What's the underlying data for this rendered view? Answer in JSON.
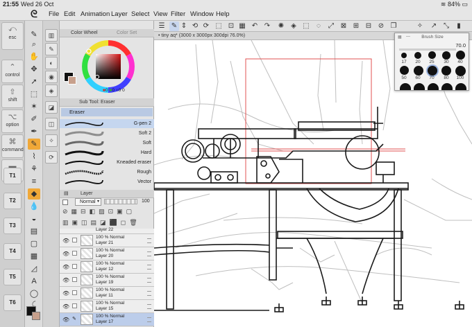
{
  "status": {
    "time": "21:55",
    "date": "Wed 26 Oct",
    "battery": "84%"
  },
  "menu": [
    "File",
    "Edit",
    "Animation",
    "Layer",
    "Select",
    "View",
    "Filter",
    "Window",
    "Help"
  ],
  "modifiers": [
    {
      "label": "esc",
      "icon": "esc-icon"
    },
    {
      "label": "control",
      "icon": "control-icon"
    },
    {
      "label": "shift",
      "icon": "shift-icon"
    },
    {
      "label": "option",
      "icon": "option-icon"
    },
    {
      "label": "command",
      "icon": "command-icon"
    },
    {
      "label": "space",
      "icon": "space-icon"
    }
  ],
  "tkeys": [
    "T1",
    "T2",
    "T3",
    "T4",
    "T5",
    "T6"
  ],
  "color_wheel": {
    "tab_active": "Color Wheel",
    "tab_inactive": "Color Set",
    "values": [
      "0",
      "0",
      "0",
      "0"
    ]
  },
  "subtool": {
    "header": "Sub Tool: Eraser",
    "active_group": "Eraser"
  },
  "brushes": [
    {
      "name": "G-pen 2",
      "selected": true
    },
    {
      "name": "Soft 2",
      "selected": false
    },
    {
      "name": "Soft",
      "selected": false
    },
    {
      "name": "Hard",
      "selected": false
    },
    {
      "name": "Kneaded eraser",
      "selected": false
    },
    {
      "name": "Rough",
      "selected": false
    },
    {
      "name": "Vector",
      "selected": false
    }
  ],
  "layer_panel": {
    "title": "Layer",
    "blend_mode": "Normal",
    "opacity": "100"
  },
  "layers": [
    {
      "mode": "",
      "name": "Layer 22",
      "selected": false
    },
    {
      "mode": "100 % Normal",
      "name": "Layer 21",
      "selected": false
    },
    {
      "mode": "100 % Normal",
      "name": "Layer 20",
      "selected": false
    },
    {
      "mode": "100 % Normal",
      "name": "Layer 12",
      "selected": false
    },
    {
      "mode": "100 % Normal",
      "name": "Layer 19",
      "selected": false
    },
    {
      "mode": "100 % Normal",
      "name": "Layer 11",
      "selected": false
    },
    {
      "mode": "100 % Normal",
      "name": "Layer 15",
      "selected": false
    },
    {
      "mode": "100 % Normal",
      "name": "Layer 17",
      "selected": true
    }
  ],
  "document": {
    "tab_label": "tiny aq* (3000 x 3000px 300dpi 76.0%)"
  },
  "brush_size": {
    "title": "Brush Size",
    "value": "70.0",
    "row1": [
      "17",
      "20",
      "25",
      "30",
      "40"
    ],
    "row2": [
      "50",
      "60",
      "70",
      "80",
      "100"
    ]
  },
  "colors": {
    "accent": "#f0a838",
    "selection": "#bccdea",
    "red_rect": "#e05050"
  }
}
